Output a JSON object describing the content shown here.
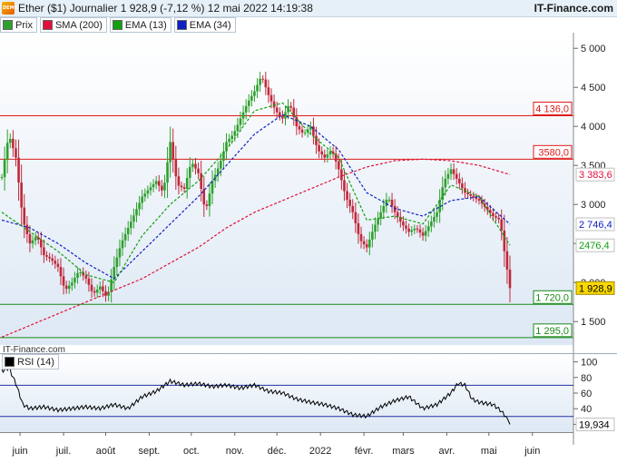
{
  "header": {
    "title": "Ether ($1) Journalier 1 928,9 (-7,12 %) 12 mai 2022 14:19:38",
    "brand": "IT-Finance.com",
    "logo_text": "DEMO"
  },
  "watermark": "IT-Finance.com",
  "legend": [
    {
      "label": "Prix",
      "color": "#2ea02e"
    },
    {
      "label": "SMA (200)",
      "color": "#e0103a"
    },
    {
      "label": "EMA (13)",
      "color": "#10a010"
    },
    {
      "label": "EMA (34)",
      "color": "#1020c0"
    }
  ],
  "rsi_legend": "RSI (14)",
  "chart_data": [
    {
      "type": "candlestick",
      "title": "Ether ($1) Journalier",
      "ylim": [
        1200,
        5200
      ],
      "y_ticks": [
        {
          "value": 5000,
          "label": "5 000"
        },
        {
          "value": 4500,
          "label": "4 500"
        },
        {
          "value": 4000,
          "label": "4 000"
        },
        {
          "value": 3500,
          "label": "3 500"
        },
        {
          "value": 3000,
          "label": "3 000"
        },
        {
          "value": 2500,
          "label": "2 500"
        },
        {
          "value": 2000,
          "label": "2 000"
        },
        {
          "value": 1500,
          "label": "1 500"
        }
      ],
      "x_labels": [
        "juin",
        "juil.",
        "août",
        "sept.",
        "oct.",
        "nov.",
        "déc.",
        "2022",
        "févr.",
        "mars",
        "avr.",
        "mai",
        "juin"
      ],
      "price_path": [
        [
          0,
          3350
        ],
        [
          5,
          3900
        ],
        [
          10,
          3600
        ],
        [
          15,
          2800
        ],
        [
          20,
          2500
        ],
        [
          25,
          2600
        ],
        [
          30,
          2350
        ],
        [
          35,
          2300
        ],
        [
          40,
          2200
        ],
        [
          45,
          1900
        ],
        [
          50,
          2000
        ],
        [
          55,
          2150
        ],
        [
          60,
          2050
        ],
        [
          65,
          1850
        ],
        [
          70,
          1950
        ],
        [
          75,
          1800
        ],
        [
          80,
          2200
        ],
        [
          85,
          2500
        ],
        [
          90,
          2700
        ],
        [
          95,
          2900
        ],
        [
          100,
          3100
        ],
        [
          105,
          3200
        ],
        [
          110,
          3300
        ],
        [
          115,
          3150
        ],
        [
          120,
          3800
        ],
        [
          125,
          3250
        ],
        [
          130,
          3200
        ],
        [
          135,
          3550
        ],
        [
          140,
          3400
        ],
        [
          145,
          2900
        ],
        [
          150,
          3300
        ],
        [
          155,
          3500
        ],
        [
          160,
          3800
        ],
        [
          165,
          3900
        ],
        [
          170,
          4100
        ],
        [
          175,
          4300
        ],
        [
          180,
          4450
        ],
        [
          185,
          4650
        ],
        [
          190,
          4400
        ],
        [
          195,
          4200
        ],
        [
          200,
          4100
        ],
        [
          205,
          4300
        ],
        [
          210,
          4000
        ],
        [
          215,
          3900
        ],
        [
          220,
          4000
        ],
        [
          225,
          3700
        ],
        [
          230,
          3600
        ],
        [
          235,
          3700
        ],
        [
          240,
          3450
        ],
        [
          245,
          3100
        ],
        [
          250,
          2900
        ],
        [
          255,
          2550
        ],
        [
          260,
          2450
        ],
        [
          265,
          2700
        ],
        [
          270,
          2900
        ],
        [
          275,
          3100
        ],
        [
          280,
          2900
        ],
        [
          285,
          2750
        ],
        [
          290,
          2650
        ],
        [
          295,
          2700
        ],
        [
          300,
          2600
        ],
        [
          305,
          2750
        ],
        [
          310,
          2900
        ],
        [
          315,
          3300
        ],
        [
          320,
          3450
        ],
        [
          325,
          3300
        ],
        [
          330,
          3150
        ],
        [
          335,
          3100
        ],
        [
          340,
          3050
        ],
        [
          345,
          2950
        ],
        [
          350,
          2850
        ],
        [
          355,
          2800
        ],
        [
          358,
          2400
        ],
        [
          362,
          1928.9
        ]
      ],
      "sma200_path": [
        [
          0,
          1300
        ],
        [
          20,
          1450
        ],
        [
          40,
          1600
        ],
        [
          60,
          1750
        ],
        [
          80,
          1900
        ],
        [
          100,
          2050
        ],
        [
          120,
          2250
        ],
        [
          140,
          2450
        ],
        [
          160,
          2700
        ],
        [
          180,
          2900
        ],
        [
          200,
          3050
        ],
        [
          220,
          3200
        ],
        [
          240,
          3350
        ],
        [
          260,
          3480
        ],
        [
          280,
          3560
        ],
        [
          300,
          3580
        ],
        [
          320,
          3560
        ],
        [
          340,
          3500
        ],
        [
          362,
          3383.6
        ]
      ],
      "ema13_path": [
        [
          0,
          2900
        ],
        [
          20,
          2650
        ],
        [
          40,
          2400
        ],
        [
          60,
          2100
        ],
        [
          80,
          2000
        ],
        [
          100,
          2600
        ],
        [
          120,
          3000
        ],
        [
          140,
          3300
        ],
        [
          160,
          3700
        ],
        [
          180,
          4200
        ],
        [
          200,
          4300
        ],
        [
          220,
          3900
        ],
        [
          240,
          3600
        ],
        [
          260,
          2800
        ],
        [
          280,
          2850
        ],
        [
          300,
          2750
        ],
        [
          320,
          3250
        ],
        [
          340,
          3100
        ],
        [
          362,
          2476.4
        ]
      ],
      "ema34_path": [
        [
          0,
          2800
        ],
        [
          20,
          2700
        ],
        [
          40,
          2500
        ],
        [
          60,
          2250
        ],
        [
          80,
          2050
        ],
        [
          100,
          2400
        ],
        [
          120,
          2750
        ],
        [
          140,
          3100
        ],
        [
          160,
          3500
        ],
        [
          180,
          3900
        ],
        [
          200,
          4150
        ],
        [
          220,
          4000
        ],
        [
          240,
          3700
        ],
        [
          260,
          3150
        ],
        [
          280,
          2950
        ],
        [
          300,
          2850
        ],
        [
          320,
          3050
        ],
        [
          340,
          3100
        ],
        [
          362,
          2746.4
        ]
      ],
      "levels": [
        {
          "value": 4136.0,
          "label": "4 136,0",
          "color": "#e01a1a"
        },
        {
          "value": 3580.0,
          "label": "3580,0",
          "color": "#e01a1a"
        },
        {
          "value": 1720.0,
          "label": "1 720,0",
          "color": "#1a8a1a"
        },
        {
          "value": 1295.0,
          "label": "1 295,0",
          "color": "#1a8a1a"
        }
      ],
      "last_tags": [
        {
          "value": 3383.6,
          "label": "3 383,6",
          "color": "#e0103a"
        },
        {
          "value": 2746.4,
          "label": "2 746,4",
          "color": "#1020c0"
        },
        {
          "value": 2476.4,
          "label": "2476,4",
          "color": "#10a010"
        },
        {
          "value": 1928.9,
          "label": "1 928,9",
          "color": "#000000"
        }
      ]
    },
    {
      "type": "line",
      "title": "RSI (14)",
      "ylim": [
        10,
        110
      ],
      "y_ticks": [
        {
          "value": 100,
          "label": "100"
        },
        {
          "value": 80,
          "label": "80"
        },
        {
          "value": 60,
          "label": "60"
        },
        {
          "value": 40,
          "label": "40"
        },
        {
          "value": 20,
          "label": ""
        }
      ],
      "levels": [
        70,
        30
      ],
      "rsi_path": [
        [
          0,
          88
        ],
        [
          5,
          92
        ],
        [
          10,
          72
        ],
        [
          15,
          45
        ],
        [
          20,
          40
        ],
        [
          30,
          42
        ],
        [
          40,
          38
        ],
        [
          50,
          40
        ],
        [
          60,
          42
        ],
        [
          70,
          40
        ],
        [
          80,
          45
        ],
        [
          90,
          40
        ],
        [
          100,
          55
        ],
        [
          110,
          62
        ],
        [
          120,
          75
        ],
        [
          130,
          70
        ],
        [
          140,
          72
        ],
        [
          150,
          68
        ],
        [
          160,
          70
        ],
        [
          170,
          66
        ],
        [
          180,
          70
        ],
        [
          190,
          62
        ],
        [
          200,
          60
        ],
        [
          210,
          52
        ],
        [
          220,
          48
        ],
        [
          230,
          45
        ],
        [
          240,
          40
        ],
        [
          250,
          32
        ],
        [
          260,
          30
        ],
        [
          270,
          42
        ],
        [
          280,
          50
        ],
        [
          290,
          55
        ],
        [
          300,
          40
        ],
        [
          310,
          45
        ],
        [
          320,
          60
        ],
        [
          325,
          72
        ],
        [
          330,
          70
        ],
        [
          335,
          52
        ],
        [
          340,
          48
        ],
        [
          350,
          45
        ],
        [
          355,
          38
        ],
        [
          360,
          28
        ],
        [
          362,
          19.934
        ]
      ],
      "last_tag": {
        "value": 19.934,
        "label": "19,934"
      }
    }
  ]
}
